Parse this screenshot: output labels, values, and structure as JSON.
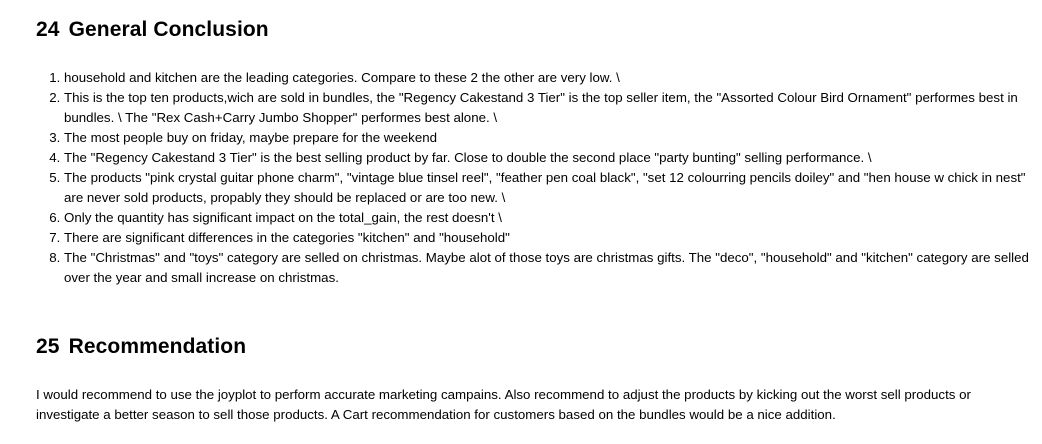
{
  "sections": [
    {
      "number": "24",
      "title": "General Conclusion",
      "items": [
        "household and kitchen are the leading categories. Compare to these 2 the other are very low. \\",
        "This is the top ten products,wich are sold in bundles, the \"Regency Cakestand 3 Tier\" is the top seller item, the \"Assorted Colour Bird Ornament\" performes best in bundles. \\ The \"Rex Cash+Carry Jumbo Shopper\" performes best alone. \\",
        "The most people buy on friday, maybe prepare for the weekend",
        "The \"Regency Cakestand 3 Tier\" is the best selling product by far. Close to double the second place \"party bunting\" selling performance. \\",
        "The products \"pink crystal guitar phone charm\", \"vintage blue tinsel reel\", \"feather pen coal black\", \"set 12 colourring pencils doiley\" and \"hen house w chick in nest\" are never sold products, propably they should be replaced or are too new. \\",
        "Only the quantity has significant impact on the total_gain, the rest doesn't \\",
        "There are significant differences in the categories \"kitchen\" and \"household\"",
        "The \"Christmas\" and \"toys\" category are selled on christmas. Maybe alot of those toys are christmas gifts. The \"deco\", \"household\" and \"kitchen\" category are selled over the year and small increase on christmas."
      ]
    },
    {
      "number": "25",
      "title": "Recommendation",
      "paragraph": "I would recommend to use the joyplot to perform accurate marketing campains. Also recommend to adjust the products by kicking out the worst sell products or investigate a better season to sell those products. A Cart recommendation for customers based on the bundles would be a nice addition."
    }
  ]
}
